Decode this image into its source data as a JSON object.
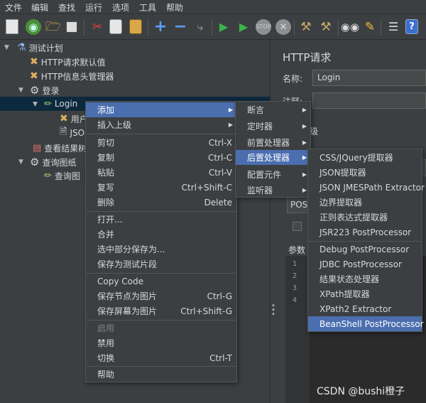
{
  "menubar": [
    "文件",
    "编辑",
    "查找",
    "运行",
    "选项",
    "工具",
    "帮助"
  ],
  "colors": {
    "selection": "#4b6eaf",
    "tree_selection": "#0d293e",
    "background": "#3c3f41"
  },
  "tree": {
    "nodes": [
      {
        "label": "测试计划",
        "icon": "flask-icon"
      },
      {
        "label": "HTTP请求默认值",
        "icon": "wrench-cross-icon"
      },
      {
        "label": "HTTP信息头管理器",
        "icon": "wrench-cross-icon"
      },
      {
        "label": "登录",
        "icon": "gear-icon"
      },
      {
        "label": "Login",
        "icon": "pipette-icon"
      },
      {
        "label": "用户",
        "icon": "wrench-cross-icon"
      },
      {
        "label": "JSO",
        "icon": "script-icon"
      },
      {
        "label": "查看结果树",
        "icon": "chart-icon"
      },
      {
        "label": "查询图纸",
        "icon": "gear-icon"
      },
      {
        "label": "查询图",
        "icon": "pipette-icon"
      }
    ]
  },
  "right_panel": {
    "title": "HTTP请求",
    "name_label": "名称:",
    "name_value": "Login",
    "note_label": "注释:",
    "frag_basic": "级",
    "frag_method": "POS",
    "frag_params": "参数",
    "line_numbers": [
      "1",
      "2",
      "3",
      "4"
    ]
  },
  "context_menu": {
    "items": [
      {
        "label": "添加",
        "shortcut": "",
        "submenu": true,
        "highlight": true
      },
      {
        "label": "插入上级",
        "shortcut": "",
        "submenu": true
      },
      {
        "label": "剪切",
        "shortcut": "Ctrl-X"
      },
      {
        "label": "复制",
        "shortcut": "Ctrl-C"
      },
      {
        "label": "粘贴",
        "shortcut": "Ctrl-V"
      },
      {
        "label": "复写",
        "shortcut": "Ctrl+Shift-C"
      },
      {
        "label": "删除",
        "shortcut": "Delete"
      },
      {
        "label": "打开...",
        "shortcut": ""
      },
      {
        "label": "合并",
        "shortcut": ""
      },
      {
        "label": "选中部分保存为...",
        "shortcut": ""
      },
      {
        "label": "保存为测试片段",
        "shortcut": ""
      },
      {
        "label": "Copy Code",
        "shortcut": ""
      },
      {
        "label": "保存节点为图片",
        "shortcut": "Ctrl-G"
      },
      {
        "label": "保存屏幕为图片",
        "shortcut": "Ctrl+Shift-G"
      },
      {
        "label": "启用",
        "shortcut": "",
        "disabled": true
      },
      {
        "label": "禁用",
        "shortcut": ""
      },
      {
        "label": "切换",
        "shortcut": "Ctrl-T"
      },
      {
        "label": "帮助",
        "shortcut": ""
      }
    ]
  },
  "add_submenu": {
    "items": [
      {
        "label": "断言",
        "submenu": true
      },
      {
        "label": "定时器",
        "submenu": true
      },
      {
        "label": "前置处理器",
        "submenu": true
      },
      {
        "label": "后置处理器",
        "submenu": true,
        "highlight": true
      },
      {
        "label": "配置元件",
        "submenu": true
      },
      {
        "label": "监听器",
        "submenu": true
      }
    ]
  },
  "post_processor_submenu": {
    "items": [
      {
        "label": "CSS/JQuery提取器"
      },
      {
        "label": "JSON提取器"
      },
      {
        "label": "JSON JMESPath Extractor"
      },
      {
        "label": "边界提取器"
      },
      {
        "label": "正则表达式提取器"
      },
      {
        "label": "JSR223 PostProcessor"
      },
      {
        "label": "Debug PostProcessor"
      },
      {
        "label": "JDBC PostProcessor"
      },
      {
        "label": "结果状态处理器"
      },
      {
        "label": "XPath提取器"
      },
      {
        "label": "XPath2 Extractor"
      },
      {
        "label": "BeanShell PostProcessor",
        "highlight": true
      }
    ]
  },
  "watermark": "CSDN @bushi橙子"
}
